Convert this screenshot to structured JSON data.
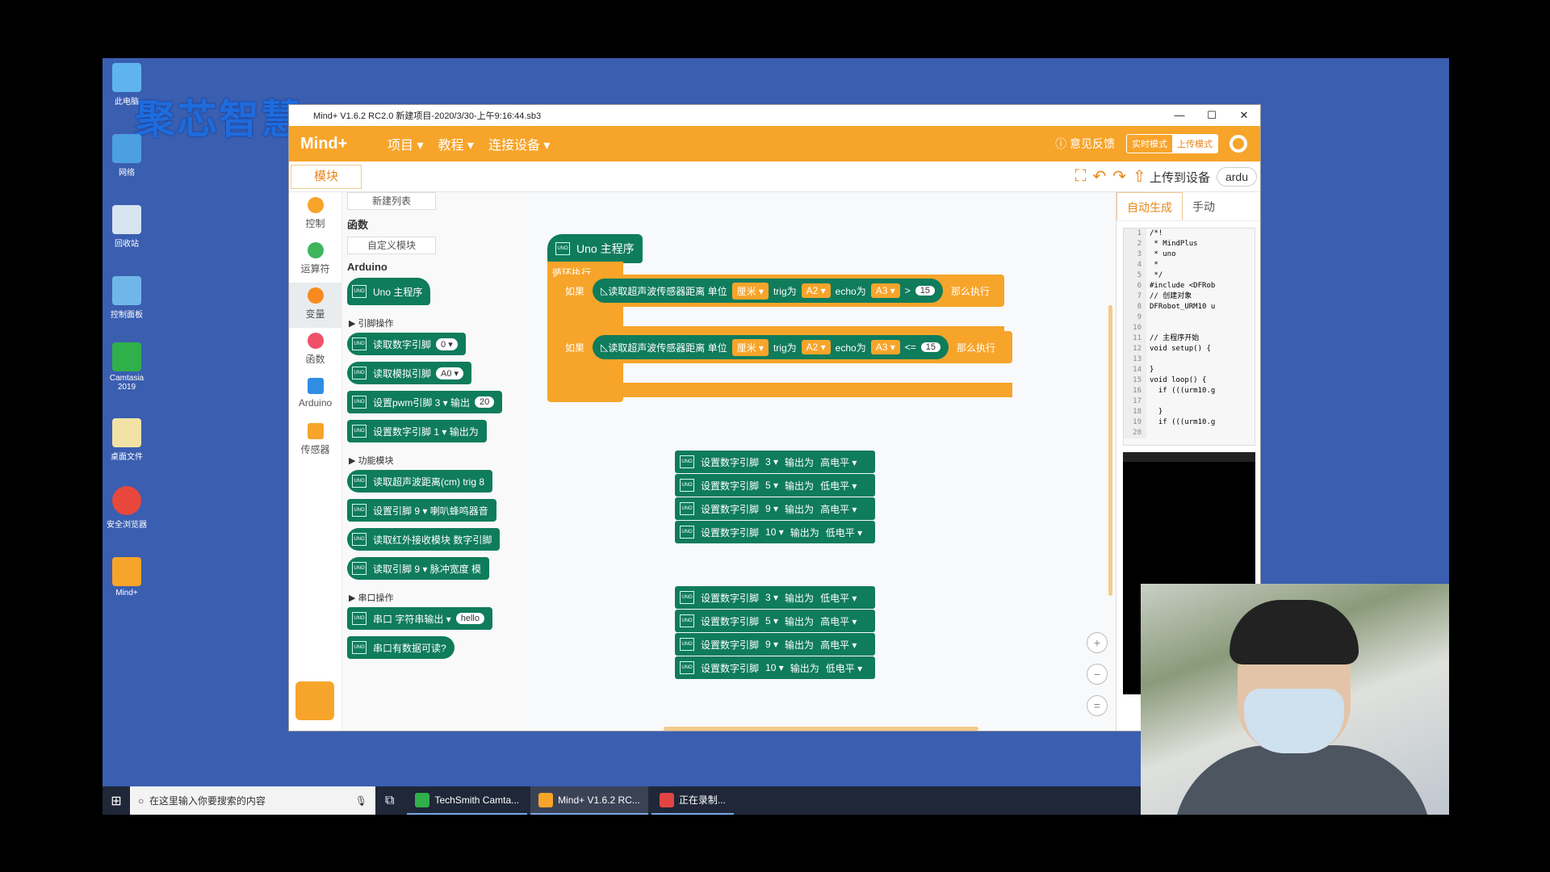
{
  "desktop": {
    "watermark": "聚芯智慧",
    "icons": [
      {
        "label": "此电脑",
        "icon": "computer-icon"
      },
      {
        "label": "网络",
        "icon": "network-icon"
      },
      {
        "label": "回收站",
        "icon": "recycle-bin-icon"
      },
      {
        "label": "控制面板",
        "icon": "control-panel-icon"
      },
      {
        "label": "Camtasia 2019",
        "icon": "camtasia-icon"
      },
      {
        "label": "桌面文件",
        "icon": "folder-icon"
      },
      {
        "label": "安全浏览器",
        "icon": "browser-icon"
      },
      {
        "label": "Mind+",
        "icon": "mindplus-icon"
      }
    ]
  },
  "window": {
    "title": "Mind+ V1.6.2 RC2.0   新建项目-2020/3/30-上午9:16:44.sb3",
    "minimize": "—",
    "maximize": "☐",
    "close": "✕"
  },
  "menubar": {
    "logo": "Mind+",
    "items": [
      "项目 ▾",
      "教程 ▾",
      "连接设备 ▾"
    ],
    "feedback": "意见反馈",
    "mode_live": "实时模式",
    "mode_upload": "上传模式"
  },
  "toolbar": {
    "tab": "模块",
    "upload": "上传到设备",
    "device": "ardu"
  },
  "categories": [
    {
      "label": "控制",
      "color": "#f7a42a"
    },
    {
      "label": "运算符",
      "color": "#3cb55d"
    },
    {
      "label": "变量",
      "color": "#f78a1e"
    },
    {
      "label": "函数",
      "color": "#ef5168"
    },
    {
      "label": "Arduino",
      "color": "#2f8de4"
    },
    {
      "label": "传感器",
      "color": "#f7a42a"
    }
  ],
  "palette": {
    "new_list": "新建列表",
    "functions_head": "函数",
    "custom_block": "自定义模块",
    "arduino_head": "Arduino",
    "uno_main": "Uno 主程序",
    "pin_ops": "引脚操作",
    "pin_blocks": [
      {
        "text": "读取数字引脚",
        "pill": "0 ▾"
      },
      {
        "text": "读取模拟引脚",
        "pill": "A0 ▾"
      },
      {
        "text": "设置pwm引脚  3 ▾  输出",
        "pill": "20"
      },
      {
        "text": "设置数字引脚  1 ▾  输出为",
        "pill": ""
      }
    ],
    "func_mods": "功能模块",
    "func_blocks": [
      {
        "text": "读取超声波距离(cm) trig  8"
      },
      {
        "text": "设置引脚  9 ▾  喇叭蜂鸣器音"
      },
      {
        "text": "读取红外接收模块 数字引脚"
      },
      {
        "text": "读取引脚  9 ▾  脉冲宽度 模"
      }
    ],
    "serial_ops": "串口操作",
    "serial_blocks": [
      {
        "text": "串口  字符串输出 ▾",
        "pill": "hello"
      },
      {
        "text": "串口有数据可读?",
        "pill": ""
      }
    ]
  },
  "workspace": {
    "hat": "Uno 主程序",
    "loop": "循环执行",
    "if1": {
      "prefix": "如果",
      "sensor": "读取超声波传感器距离 单位",
      "unit": "厘米 ▾",
      "trig_label": "trig为",
      "trig": "A2 ▾",
      "echo_label": "echo为",
      "echo": "A3 ▾",
      "op": ">",
      "value": "15",
      "then": "那么执行"
    },
    "if2": {
      "prefix": "如果",
      "sensor": "读取超声波传感器距离 单位",
      "unit": "厘米 ▾",
      "trig_label": "trig为",
      "trig": "A2 ▾",
      "echo_label": "echo为",
      "echo": "A3 ▾",
      "op": "<=",
      "value": "15",
      "then": "那么执行"
    },
    "stack1": [
      {
        "pin": "3 ▾",
        "level": "高电平 ▾"
      },
      {
        "pin": "5 ▾",
        "level": "低电平 ▾"
      },
      {
        "pin": "9 ▾",
        "level": "高电平 ▾"
      },
      {
        "pin": "10 ▾",
        "level": "低电平 ▾"
      }
    ],
    "stack2": [
      {
        "pin": "3 ▾",
        "level": "低电平 ▾"
      },
      {
        "pin": "5 ▾",
        "level": "高电平 ▾"
      },
      {
        "pin": "9 ▾",
        "level": "高电平 ▾"
      },
      {
        "pin": "10 ▾",
        "level": "低电平 ▾"
      }
    ],
    "set_pin_label": "设置数字引脚",
    "output_label": "输出为",
    "zoom_in": "+",
    "zoom_out": "−",
    "zoom_reset": "="
  },
  "code": {
    "tab_auto": "自动生成",
    "tab_manual": "手动",
    "lines": [
      {
        "n": "1",
        "t": "/*!"
      },
      {
        "n": "2",
        "t": " * MindPlus"
      },
      {
        "n": "3",
        "t": " * uno"
      },
      {
        "n": "4",
        "t": " *"
      },
      {
        "n": "5",
        "t": " */"
      },
      {
        "n": "6",
        "t": "#include <DFRob"
      },
      {
        "n": "7",
        "t": "// 创建对象"
      },
      {
        "n": "8",
        "t": "DFRobot_URM10 u"
      },
      {
        "n": "9",
        "t": ""
      },
      {
        "n": "10",
        "t": ""
      },
      {
        "n": "11",
        "t": "// 主程序开始"
      },
      {
        "n": "12",
        "t": "void setup() {"
      },
      {
        "n": "13",
        "t": ""
      },
      {
        "n": "14",
        "t": "}"
      },
      {
        "n": "15",
        "t": "void loop() {"
      },
      {
        "n": "16",
        "t": "  if (((urm10.g"
      },
      {
        "n": "17",
        "t": ""
      },
      {
        "n": "18",
        "t": "  }"
      },
      {
        "n": "19",
        "t": "  if (((urm10.g"
      },
      {
        "n": "20",
        "t": ""
      }
    ]
  },
  "taskbar": {
    "search_placeholder": "在这里输入你要搜索的内容",
    "apps": [
      {
        "label": "TechSmith Camta...",
        "color": "#2fb04a"
      },
      {
        "label": "Mind+ V1.6.2 RC...",
        "color": "#f7a42a"
      },
      {
        "label": "正在录制...",
        "color": "#e24444"
      }
    ]
  }
}
